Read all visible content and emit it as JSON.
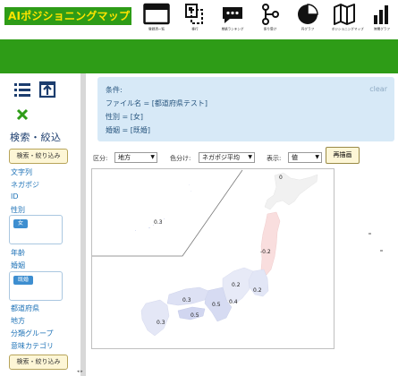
{
  "header": {
    "logo": "AIポジショニングマップ",
    "nav": [
      {
        "label": "登録済一覧",
        "icon": "window-icon"
      },
      {
        "label": "移行",
        "icon": "copy-icon"
      },
      {
        "label": "単語ランキング",
        "icon": "chat-bubble-icon"
      },
      {
        "label": "係り受け",
        "icon": "dependency-tree-icon"
      },
      {
        "label": "円グラフ",
        "icon": "pie-chart-icon"
      },
      {
        "label": "ポジショニングマップ",
        "icon": "map-icon"
      },
      {
        "label": "時間グラフ",
        "icon": "bar-chart-icon"
      }
    ],
    "brand_color": "#2e9c17",
    "logo_text_color": "#ffe400"
  },
  "sidebar": {
    "title": "検索・絞込",
    "filter_button": "検索・絞り込み",
    "links_top": [
      "文字列",
      "ネガポジ",
      "ID",
      "性別"
    ],
    "gender_tag": "女",
    "links_mid": [
      "年齢",
      "婚姻"
    ],
    "marital_tag": "既婚",
    "links_bottom": [
      "都道府県",
      "地方",
      "分類グループ",
      "意味カテゴリ"
    ],
    "filter_button_bottom": "検索・絞り込み"
  },
  "conditions": {
    "heading": "条件:",
    "lines": [
      "ファイル名 = [都道府県テスト]",
      "性別 = [女]",
      "婚姻 = [既婚]"
    ],
    "clear": "clear"
  },
  "controls": {
    "kubun_label": "区分:",
    "kubun_value": "地方",
    "color_label": "色分け:",
    "color_value": "ネガポジ平均",
    "display_label": "表示:",
    "display_value": "値",
    "redraw": "再描画"
  },
  "map": {
    "values": [
      "0",
      "0.3",
      "-0.2",
      "0.2",
      "0.2",
      "0.3",
      "0.5",
      "0.4",
      "0.5",
      "0.3"
    ]
  }
}
